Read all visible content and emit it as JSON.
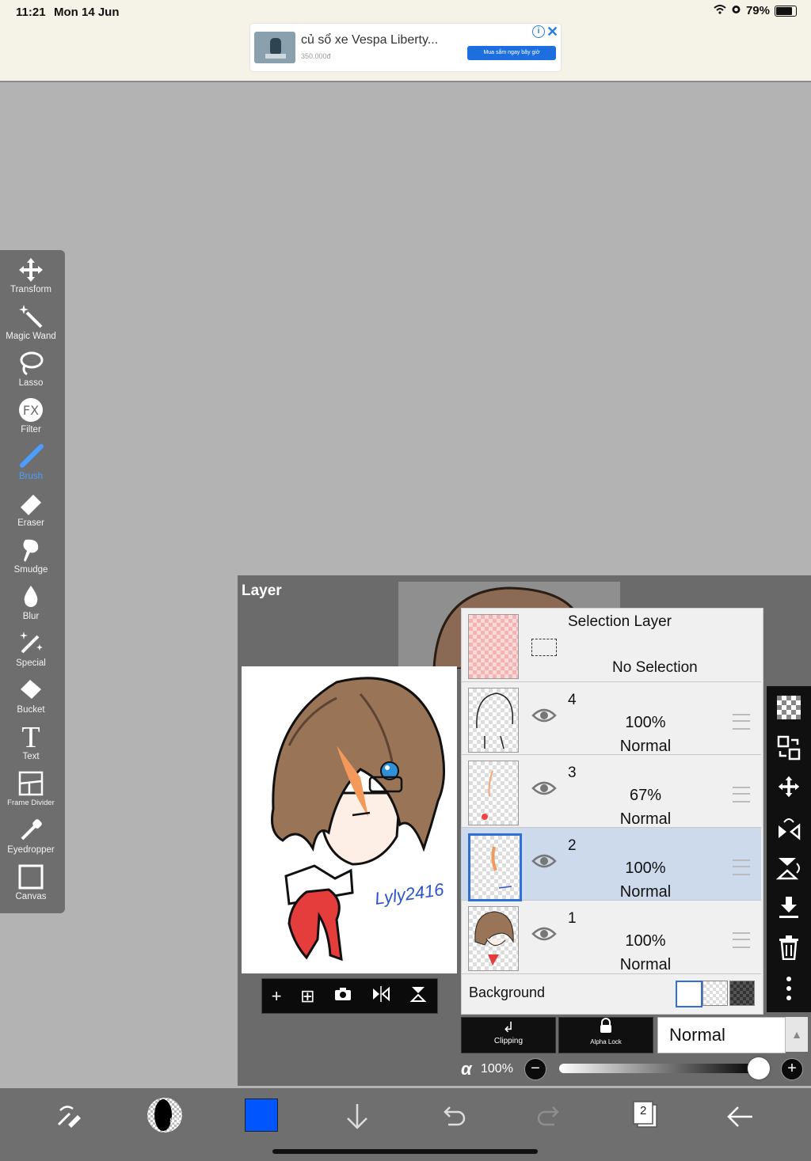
{
  "status": {
    "time": "11:21",
    "date": "Mon 14 Jun",
    "battery": "79%",
    "icons": [
      "wifi-icon",
      "alarm-icon",
      "battery-icon"
    ]
  },
  "ad": {
    "title": "củ sổ xe Vespa Liberty...",
    "price": "350.000đ",
    "cta": "Mua sắm ngay bây giờ",
    "info": "i",
    "close": "✕"
  },
  "tools": [
    {
      "label": "Transform",
      "icon": "move-icon"
    },
    {
      "label": "Magic Wand",
      "icon": "magic-wand-icon"
    },
    {
      "label": "Lasso",
      "icon": "lasso-icon"
    },
    {
      "label": "Filter",
      "icon": "fx-icon"
    },
    {
      "label": "Brush",
      "icon": "brush-icon",
      "active": true
    },
    {
      "label": "Eraser",
      "icon": "eraser-icon"
    },
    {
      "label": "Smudge",
      "icon": "smudge-icon"
    },
    {
      "label": "Blur",
      "icon": "drop-icon"
    },
    {
      "label": "Special",
      "icon": "sparkle-icon"
    },
    {
      "label": "Bucket",
      "icon": "bucket-icon"
    },
    {
      "label": "Text",
      "icon": "text-icon"
    },
    {
      "label": "Frame Divider",
      "icon": "frame-divider-icon"
    },
    {
      "label": "Eyedropper",
      "icon": "eyedropper-icon"
    },
    {
      "label": "Canvas",
      "icon": "canvas-icon"
    }
  ],
  "panel": {
    "title": "Layer",
    "selection": {
      "title": "Selection Layer",
      "status": "No Selection"
    },
    "layers": [
      {
        "num": "4",
        "opacity": "100%",
        "mode": "Normal"
      },
      {
        "num": "3",
        "opacity": "67%",
        "mode": "Normal"
      },
      {
        "num": "2",
        "opacity": "100%",
        "mode": "Normal",
        "selected": true
      },
      {
        "num": "1",
        "opacity": "100%",
        "mode": "Normal"
      }
    ],
    "background_label": "Background",
    "clipping_label": "Clipping",
    "alpha_lock_label": "Alpha Lock",
    "blend_mode": "Normal",
    "alpha_symbol": "α",
    "alpha_value": "100%",
    "opacity_fraction": 1.0,
    "signature_text": "Lyly2416"
  },
  "colors": {
    "accent": "#4a9eff",
    "selected_row": "#cddaeb",
    "current_color": "#0055ff"
  },
  "bottom": {
    "layers_count": "2"
  }
}
